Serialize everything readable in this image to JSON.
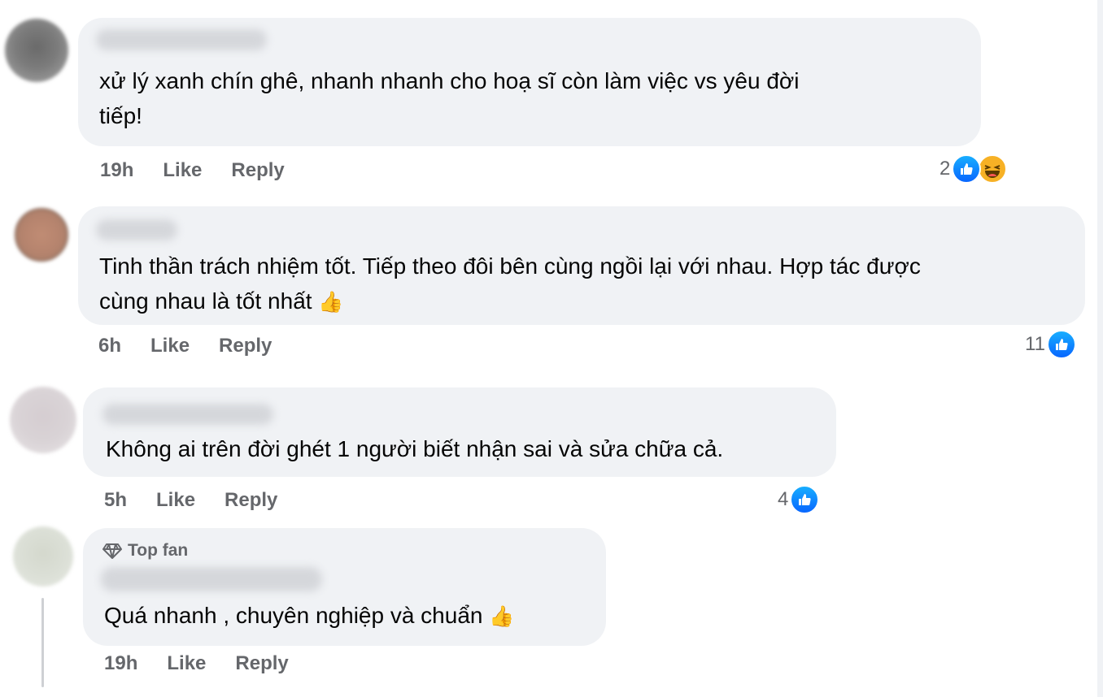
{
  "comments": [
    {
      "text_lines": [
        "xử lý xanh chín ghê, nhanh nhanh cho hoạ sĩ còn làm việc vs yêu đời",
        "tiếp!"
      ],
      "time": "19h",
      "like_label": "Like",
      "reply_label": "Reply",
      "reaction_count": "2",
      "reactions": [
        "like-icon",
        "haha-icon"
      ]
    },
    {
      "text_lines": [
        "Tinh thần trách nhiệm tốt. Tiếp theo đôi bên cùng ngồi lại với nhau. Hợp tác được",
        "cùng nhau là tốt nhất"
      ],
      "emoji": "👍",
      "time": "6h",
      "like_label": "Like",
      "reply_label": "Reply",
      "reaction_count": "11",
      "reactions": [
        "like-icon"
      ]
    },
    {
      "text_lines": [
        "Không ai trên đời ghét 1 người biết nhận sai và sửa chữa cả."
      ],
      "time": "5h",
      "like_label": "Like",
      "reply_label": "Reply",
      "reaction_count": "4",
      "reactions": [
        "like-icon"
      ]
    },
    {
      "badge": "Top fan",
      "badge_icon": "diamond-icon",
      "text_lines": [
        "Quá nhanh , chuyên nghiệp và chuẩn"
      ],
      "emoji": "👍",
      "time": "19h",
      "like_label": "Like",
      "reply_label": "Reply"
    }
  ],
  "colors": {
    "bubble": "#f0f2f5",
    "meta_text": "#65676b",
    "like_blue": "#0866ff",
    "haha_yellow": "#f7b125"
  }
}
